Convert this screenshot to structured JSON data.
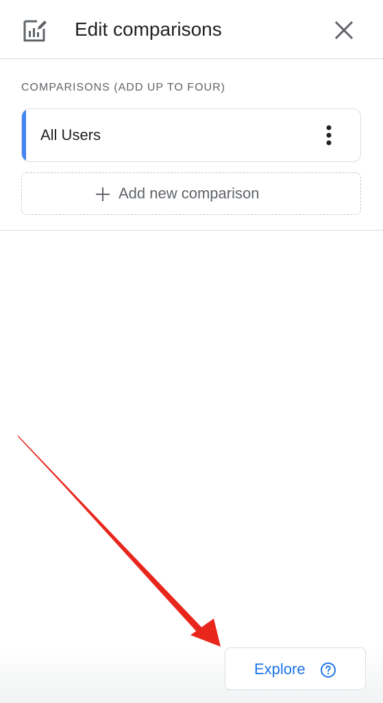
{
  "header": {
    "title": "Edit comparisons",
    "icon": "edit-chart-icon",
    "close_icon": "close-icon"
  },
  "comparisons": {
    "section_label": "COMPARISONS (ADD UP TO FOUR)",
    "items": [
      {
        "label": "All Users",
        "accent_color": "#4285f4",
        "menu_icon": "more-vert-icon"
      }
    ],
    "add_label": "Add new comparison",
    "add_icon": "plus-icon"
  },
  "footer": {
    "explore_label": "Explore",
    "help_icon": "help-circle-icon"
  },
  "colors": {
    "accent_blue": "#4285f4",
    "link_blue": "#1a73e8",
    "annotation_arrow": "#e8261c"
  }
}
